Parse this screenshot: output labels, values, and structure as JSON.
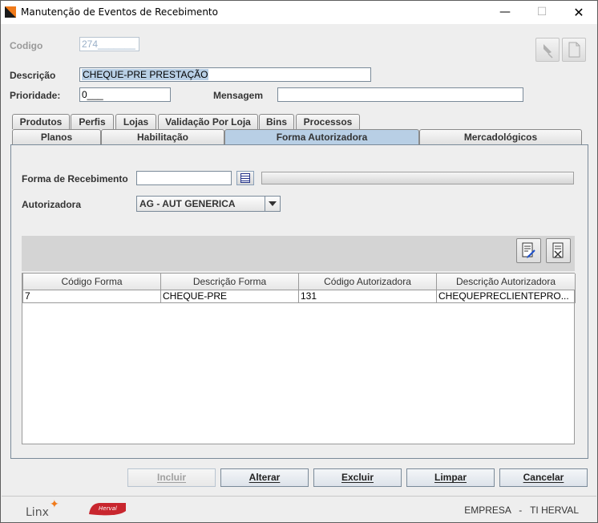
{
  "window": {
    "title": "Manutenção de Eventos de Recebimento",
    "minimize": "—",
    "maximize": "☐",
    "close": "✕"
  },
  "form": {
    "codigo_label": "Codigo",
    "codigo_value": "274_______",
    "descricao_label": "Descrição",
    "descricao_value": "CHEQUE-PRE PRESTAÇÃO",
    "prioridade_label": "Prioridade:",
    "prioridade_value": "0___",
    "mensagem_label": "Mensagem",
    "mensagem_value": ""
  },
  "toolbar_icons": [
    "pin-icon",
    "document-icon"
  ],
  "tabs_row1": [
    {
      "label": "Produtos"
    },
    {
      "label": "Perfis"
    },
    {
      "label": "Lojas"
    },
    {
      "label": "Validação Por Loja"
    },
    {
      "label": "Bins"
    },
    {
      "label": "Processos"
    }
  ],
  "tabs_row2": [
    {
      "label": "Planos"
    },
    {
      "label": "Habilitação"
    },
    {
      "label": "Forma Autorizadora",
      "active": true
    },
    {
      "label": "Mercadológicos"
    }
  ],
  "panel": {
    "forma_label": "Forma de Recebimento",
    "forma_value": "",
    "autorizadora_label": "Autorizadora",
    "autorizadora_value": "AG - AUT GENERICA"
  },
  "grid": {
    "columns": [
      "Código Forma",
      "Descrição Forma",
      "Código Autorizadora",
      "Descrição Autorizadora"
    ],
    "rows": [
      [
        "7",
        "CHEQUE-PRE",
        "131",
        "CHEQUEPRECLIENTEPRO..."
      ]
    ]
  },
  "buttons": {
    "incluir": "Incluir",
    "alterar": "Alterar",
    "excluir": "Excluir",
    "limpar": "Limpar",
    "cancelar": "Cancelar"
  },
  "status": {
    "linx": "Linx",
    "herval": "Herval",
    "empresa_label": "EMPRESA",
    "separator": "-",
    "empresa_value": "TI HERVAL"
  },
  "colors": {
    "active_tab": "#b8cfe5",
    "selection": "#b8cfe5",
    "brand_orange": "#f07a1a",
    "herval_red": "#c8262e"
  }
}
